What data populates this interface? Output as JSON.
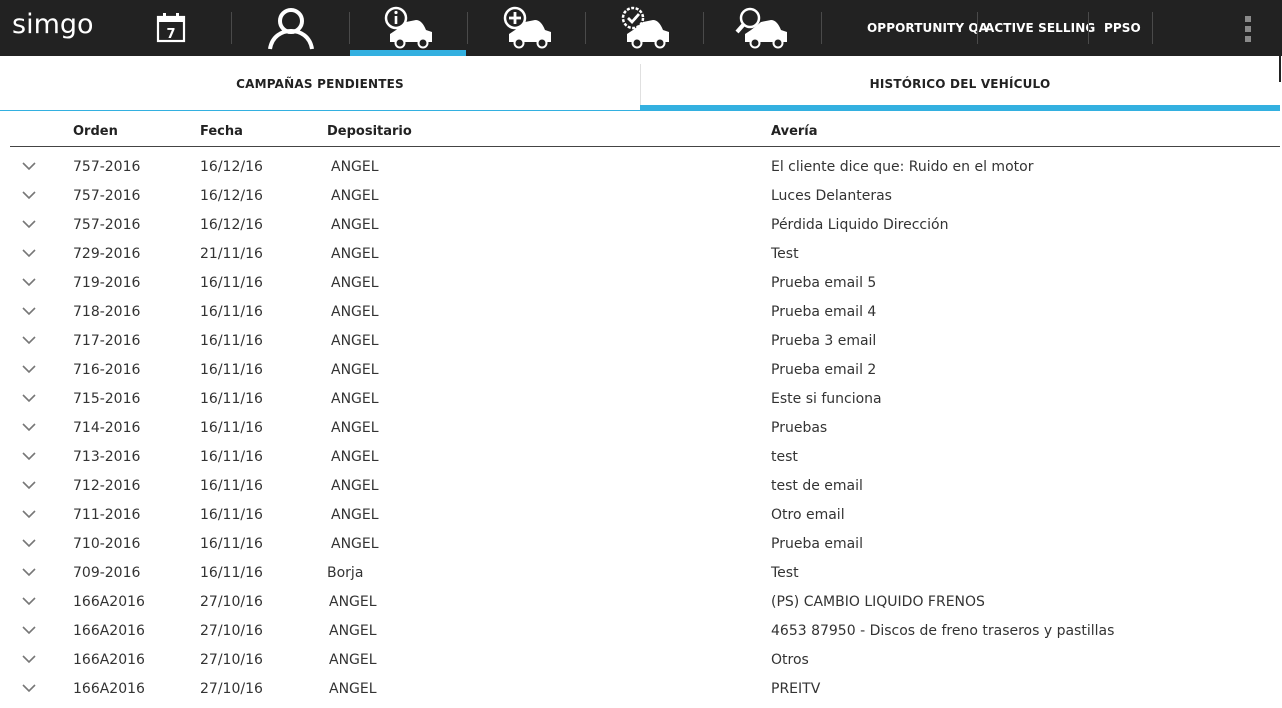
{
  "app": {
    "logo_text": "simgo",
    "colors": {
      "topbar": "#222222",
      "accent": "#33b0e0"
    }
  },
  "nav": {
    "icons": [
      {
        "name": "calendar-icon",
        "day": "7"
      },
      {
        "name": "user-icon"
      },
      {
        "name": "car-info-icon",
        "active": true
      },
      {
        "name": "car-add-icon"
      },
      {
        "name": "car-check-icon"
      },
      {
        "name": "car-search-icon"
      }
    ],
    "text_items": [
      "OPPORTUNITY QA",
      "ACTIVE SELLING",
      "PPSO"
    ],
    "menu_icon": "more-vert-icon"
  },
  "tabs": [
    {
      "label": "CAMPAÑAS PENDIENTES",
      "active": false
    },
    {
      "label": "HISTÓRICO DEL VEHÍCULO",
      "active": true
    }
  ],
  "table": {
    "headers": {
      "orden": "Orden",
      "fecha": "Fecha",
      "depositario": "Depositario",
      "averia": "Avería"
    },
    "rows": [
      {
        "orden": "757-2016",
        "fecha": "16/12/16",
        "depositario": "ANGEL",
        "averia": "El cliente dice que: Ruido en el motor"
      },
      {
        "orden": "757-2016",
        "fecha": "16/12/16",
        "depositario": "ANGEL",
        "averia": "Luces Delanteras"
      },
      {
        "orden": "757-2016",
        "fecha": "16/12/16",
        "depositario": "ANGEL",
        "averia": "Pérdida Liquido Dirección"
      },
      {
        "orden": "729-2016",
        "fecha": "21/11/16",
        "depositario": "ANGEL",
        "averia": "Test"
      },
      {
        "orden": "719-2016",
        "fecha": "16/11/16",
        "depositario": "ANGEL",
        "averia": "Prueba email 5"
      },
      {
        "orden": "718-2016",
        "fecha": "16/11/16",
        "depositario": "ANGEL",
        "averia": "Prueba email 4"
      },
      {
        "orden": "717-2016",
        "fecha": "16/11/16",
        "depositario": "ANGEL",
        "averia": "Prueba 3 email"
      },
      {
        "orden": "716-2016",
        "fecha": "16/11/16",
        "depositario": "ANGEL",
        "averia": "Prueba email 2"
      },
      {
        "orden": "715-2016",
        "fecha": "16/11/16",
        "depositario": "ANGEL",
        "averia": "Este si funciona"
      },
      {
        "orden": "714-2016",
        "fecha": "16/11/16",
        "depositario": "ANGEL",
        "averia": "Pruebas"
      },
      {
        "orden": "713-2016",
        "fecha": "16/11/16",
        "depositario": "ANGEL",
        "averia": "test"
      },
      {
        "orden": "712-2016",
        "fecha": "16/11/16",
        "depositario": "ANGEL",
        "averia": "test de email"
      },
      {
        "orden": "711-2016",
        "fecha": "16/11/16",
        "depositario": "ANGEL",
        "averia": "Otro email"
      },
      {
        "orden": "710-2016",
        "fecha": "16/11/16",
        "depositario": "ANGEL",
        "averia": "Prueba email"
      },
      {
        "orden": "709-2016",
        "fecha": "16/11/16",
        "depositario": "Borja",
        "averia": "Test"
      },
      {
        "orden": "166A2016",
        "fecha": "27/10/16",
        "depositario": "ANGEL",
        "averia": "(PS) CAMBIO LIQUIDO FRENOS"
      },
      {
        "orden": "166A2016",
        "fecha": "27/10/16",
        "depositario": "ANGEL",
        "averia": "4653 87950 - Discos de freno traseros y pastillas"
      },
      {
        "orden": "166A2016",
        "fecha": "27/10/16",
        "depositario": "ANGEL",
        "averia": "Otros"
      },
      {
        "orden": "166A2016",
        "fecha": "27/10/16",
        "depositario": "ANGEL",
        "averia": "PREITV"
      }
    ]
  }
}
